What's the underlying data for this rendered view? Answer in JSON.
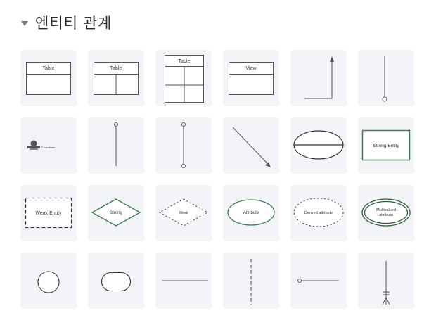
{
  "panel": {
    "title": "엔티티 관계",
    "collapse_icon": "caret-down-icon"
  },
  "shapes": {
    "table": "Table",
    "view": "View",
    "coordinate": "Coordinate",
    "strong_entity": "Strong Entity",
    "weak_entity": "Weak Entity",
    "strong": "Strong",
    "weak": "Weak",
    "attribute": "Attribute",
    "derived_attribute": "Derived attribute",
    "multivalued_line1": "Multivalued",
    "multivalued_line2": "attribute"
  },
  "colors": {
    "tile_bg": "#f3f4f8",
    "stroke": "#555555",
    "entity_green": "#3b7a4f",
    "multivalued_green": "#2f5e3c"
  }
}
